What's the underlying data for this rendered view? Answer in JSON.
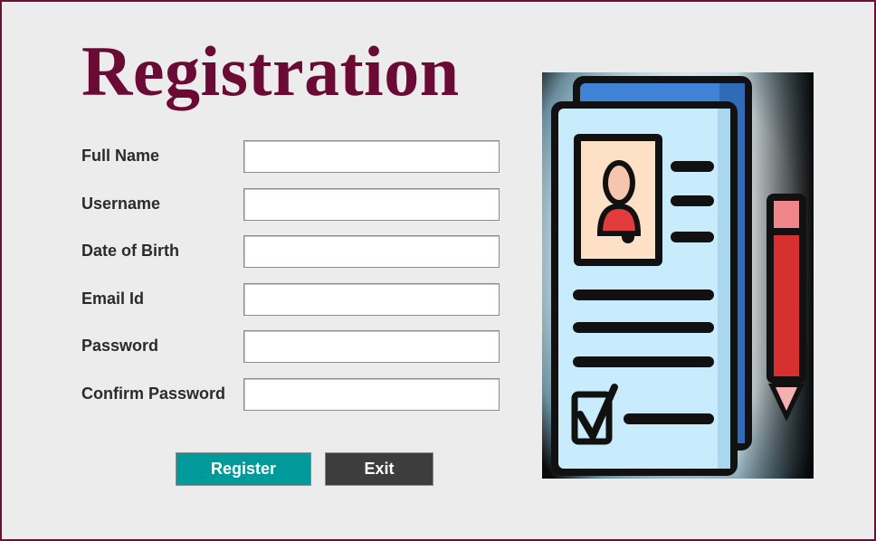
{
  "window": {
    "title": "Registration"
  },
  "form": {
    "fields": [
      {
        "label": "Full Name",
        "value": "",
        "placeholder": ""
      },
      {
        "label": "Username",
        "value": "",
        "placeholder": ""
      },
      {
        "label": "Date of Birth",
        "value": "",
        "placeholder": ""
      },
      {
        "label": "Email Id",
        "value": "",
        "placeholder": ""
      },
      {
        "label": "Password",
        "value": "",
        "placeholder": ""
      },
      {
        "label": "Confirm Password",
        "value": "",
        "placeholder": ""
      }
    ]
  },
  "buttons": {
    "register_label": "Register",
    "exit_label": "Exit"
  },
  "illustration": {
    "icon": "registration-form-illustration"
  },
  "colors": {
    "title": "#6a0a35",
    "border": "#6b0f35",
    "register_bg": "#009a9a",
    "exit_bg": "#3d3d3d",
    "background": "#ececec"
  }
}
